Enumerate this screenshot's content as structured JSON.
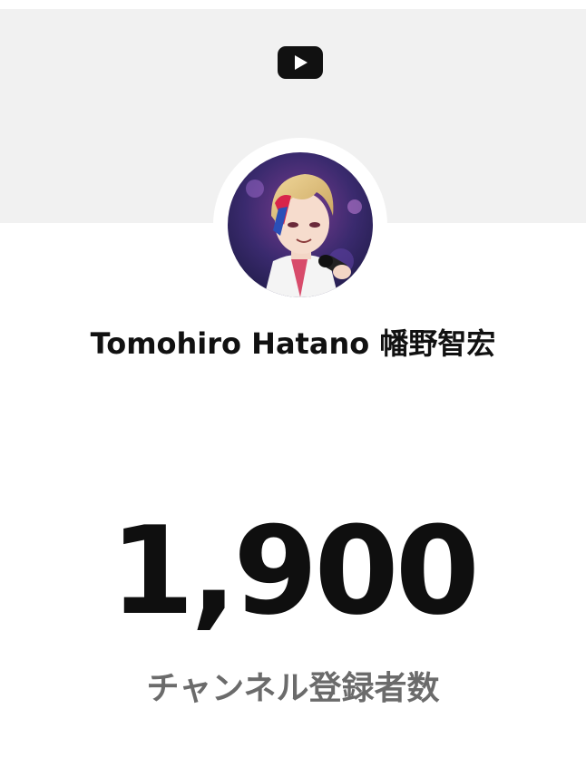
{
  "header": {
    "logo_icon": "youtube-play-icon",
    "band_color": "#f1f1f1"
  },
  "channel": {
    "name": "Tomohiro Hatano 幡野智宏",
    "avatar_icon": "avatar-illustration"
  },
  "subscribers": {
    "count": "1,900",
    "label": "チャンネル登録者数"
  }
}
